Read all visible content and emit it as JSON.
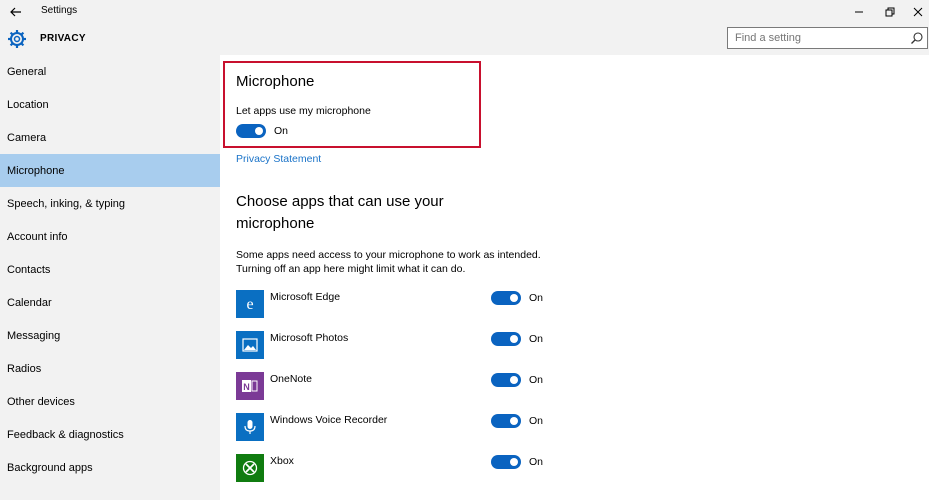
{
  "window": {
    "title": "Settings",
    "controls": [
      "minimize",
      "restore",
      "close"
    ]
  },
  "header": {
    "title": "PRIVACY",
    "search_placeholder": "Find a setting"
  },
  "sidebar": {
    "items": [
      {
        "label": "General"
      },
      {
        "label": "Location"
      },
      {
        "label": "Camera"
      },
      {
        "label": "Microphone",
        "active": true
      },
      {
        "label": "Speech, inking, & typing"
      },
      {
        "label": "Account info"
      },
      {
        "label": "Contacts"
      },
      {
        "label": "Calendar"
      },
      {
        "label": "Messaging"
      },
      {
        "label": "Radios"
      },
      {
        "label": "Other devices"
      },
      {
        "label": "Feedback & diagnostics"
      },
      {
        "label": "Background apps"
      }
    ]
  },
  "main": {
    "title": "Microphone",
    "toggle_label": "Let apps use my microphone",
    "toggle_state": "On",
    "privacy_link": "Privacy Statement",
    "apps_heading_line1": "Choose apps that can use your",
    "apps_heading_line2": "microphone",
    "description_line1": "Some apps need access to your microphone to work as intended.",
    "description_line2": "Turning off an app here might limit what it can do.",
    "apps": [
      {
        "name": "Microsoft Edge",
        "state": "On",
        "icon": "edge-icon",
        "color": "#0a6fc2"
      },
      {
        "name": "Microsoft Photos",
        "state": "On",
        "icon": "photos-icon",
        "color": "#0a6fc2"
      },
      {
        "name": "OneNote",
        "state": "On",
        "icon": "onenote-icon",
        "color": "#7b3a96"
      },
      {
        "name": "Windows Voice Recorder",
        "state": "On",
        "icon": "voice-recorder-icon",
        "color": "#0a6fc2"
      },
      {
        "name": "Xbox",
        "state": "On",
        "icon": "xbox-icon",
        "color": "#107c10"
      }
    ]
  },
  "colors": {
    "accent": "#0a63c0",
    "sidebar_active": "#a8cdee",
    "highlight_border": "#c8102e",
    "link": "#1a73c8"
  }
}
